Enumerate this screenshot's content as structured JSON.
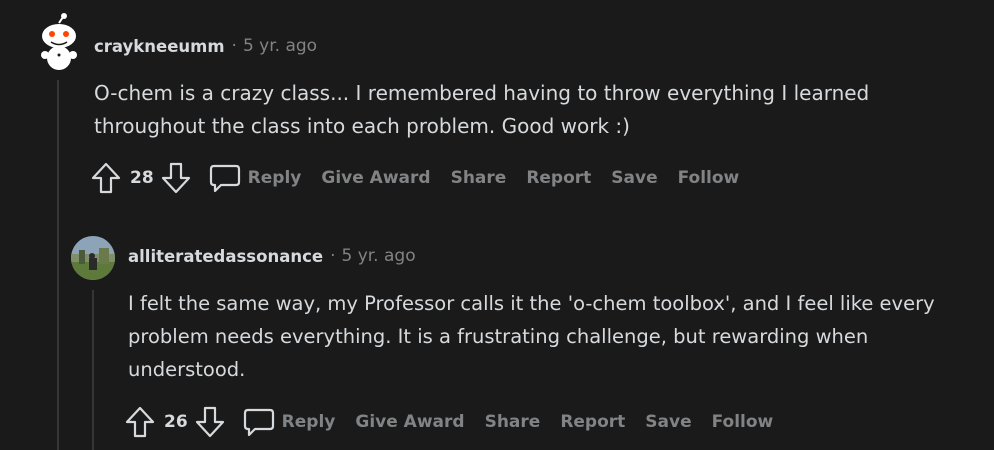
{
  "comments": [
    {
      "author": "craykneeumm",
      "separator": "·",
      "age": "5 yr. ago",
      "lines": [
        "O-chem is a crazy class... I remembered having to throw everything I learned",
        "throughout the class into each problem. Good work :)"
      ],
      "score": "28",
      "actions": {
        "reply": "Reply",
        "give_award": "Give Award",
        "share": "Share",
        "report": "Report",
        "save": "Save",
        "follow": "Follow"
      }
    },
    {
      "author": "alliteratedassonance",
      "separator": "·",
      "age": "5 yr. ago",
      "lines": [
        "I felt the same way, my Professor calls it the 'o-chem toolbox', and I feel like every",
        "problem needs everything. It is a frustrating challenge, but rewarding when",
        "understood."
      ],
      "score": "26",
      "actions": {
        "reply": "Reply",
        "give_award": "Give Award",
        "share": "Share",
        "report": "Report",
        "save": "Save",
        "follow": "Follow"
      }
    }
  ],
  "colors": {
    "background": "#1a1a1b",
    "text": "#d7dadc",
    "muted": "#818384",
    "thread_line": "#343536"
  },
  "icons": [
    "snoo-avatar-icon",
    "upvote-icon",
    "downvote-icon",
    "reply-icon"
  ]
}
